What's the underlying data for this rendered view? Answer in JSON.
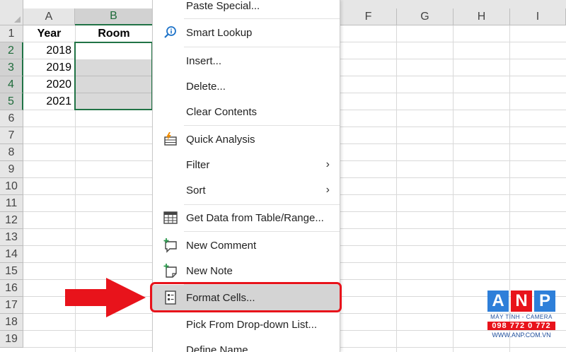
{
  "columns": [
    {
      "label": "A",
      "selected": false
    },
    {
      "label": "B",
      "selected": true
    },
    {
      "label": "F",
      "selected": false
    },
    {
      "label": "G",
      "selected": false
    },
    {
      "label": "H",
      "selected": false
    },
    {
      "label": "I",
      "selected": false
    }
  ],
  "rows": [
    "1",
    "2",
    "3",
    "4",
    "5",
    "6",
    "7",
    "8",
    "9",
    "10",
    "11",
    "12",
    "13",
    "14",
    "15",
    "16",
    "17",
    "18",
    "19"
  ],
  "selected_rows": [
    "2",
    "3",
    "4",
    "5"
  ],
  "cells": {
    "a1": "Year",
    "b1": "Room",
    "a2": "2018",
    "a3": "2019",
    "a4": "2020",
    "a5": "2021"
  },
  "context_menu": {
    "items": [
      {
        "label": "Paste Special...",
        "icon": "none"
      },
      {
        "label": "Smart Lookup",
        "icon": "smart-lookup-icon"
      },
      {
        "label": "Insert...",
        "icon": "none"
      },
      {
        "label": "Delete...",
        "icon": "none"
      },
      {
        "label": "Clear Contents",
        "icon": "none"
      },
      {
        "label": "Quick Analysis",
        "icon": "quick-analysis-icon"
      },
      {
        "label": "Filter",
        "icon": "none",
        "submenu": true
      },
      {
        "label": "Sort",
        "icon": "none",
        "submenu": true
      },
      {
        "label": "Get Data from Table/Range...",
        "icon": "table-icon"
      },
      {
        "label": "New Comment",
        "icon": "new-comment-icon"
      },
      {
        "label": "New Note",
        "icon": "new-note-icon"
      },
      {
        "label": "Format Cells...",
        "icon": "format-cells-icon",
        "highlighted": true
      },
      {
        "label": "Pick From Drop-down List...",
        "icon": "none"
      },
      {
        "label": "Define Name...",
        "icon": "none"
      }
    ],
    "submenu_glyph": "›"
  },
  "logo": {
    "letters": [
      "A",
      "N",
      "P"
    ],
    "letter_colors": [
      "#2e7fd9",
      "#e8131b",
      "#2e7fd9"
    ],
    "tagline": "MÁY TÍNH - CAMERA",
    "phone": "098 772 0 772",
    "site": "WWW.ANP.COM.VN"
  },
  "colors": {
    "excel_green": "#217346",
    "highlight_red": "#e8131b",
    "arrow_red": "#e8131b"
  }
}
